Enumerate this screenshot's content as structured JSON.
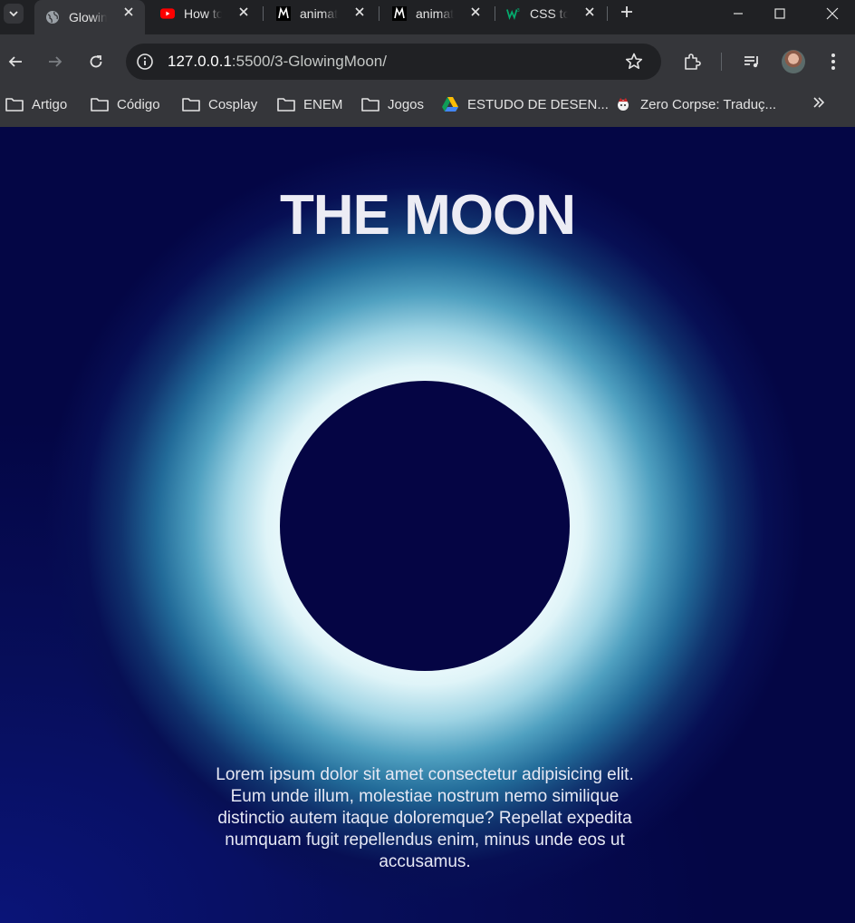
{
  "browser": {
    "tabs": [
      {
        "title": "Glowing Moon",
        "favicon": "globe-icon",
        "active": true
      },
      {
        "title": "How to",
        "favicon": "youtube-icon",
        "active": false
      },
      {
        "title": "animation",
        "favicon": "m-logo-icon",
        "active": false
      },
      {
        "title": "animation",
        "favicon": "m-logo-icon",
        "active": false
      },
      {
        "title": "CSS to",
        "favicon": "w3schools-icon",
        "active": false
      }
    ],
    "url": {
      "host": "127.0.0.1",
      "rest": ":5500/3-GlowingMoon/"
    },
    "bookmarks": [
      {
        "label": "Artigo",
        "icon": "folder-icon"
      },
      {
        "label": "Código",
        "icon": "folder-icon"
      },
      {
        "label": "Cosplay",
        "icon": "folder-icon"
      },
      {
        "label": "ENEM",
        "icon": "folder-icon"
      },
      {
        "label": "Jogos",
        "icon": "folder-icon"
      },
      {
        "label": "ESTUDO DE DESEN...",
        "icon": "google-drive-icon"
      },
      {
        "label": "Zero Corpse: Traduç...",
        "icon": "site-favicon-icon"
      }
    ]
  },
  "page": {
    "title": "THE MOON",
    "paragraph": "Lorem ipsum dolor sit amet consectetur adipisicing elit. Eum unde illum, molestiae nostrum nemo similique distinctio autem itaque doloremque? Repellat expedita numquam fugit repellendus enim, minus unde eos ut accusamus."
  },
  "colors": {
    "page_background": "#040645",
    "moon": "#050544",
    "glow": "#ffffff",
    "browser_frame": "#202124",
    "toolbar": "#35363a"
  }
}
